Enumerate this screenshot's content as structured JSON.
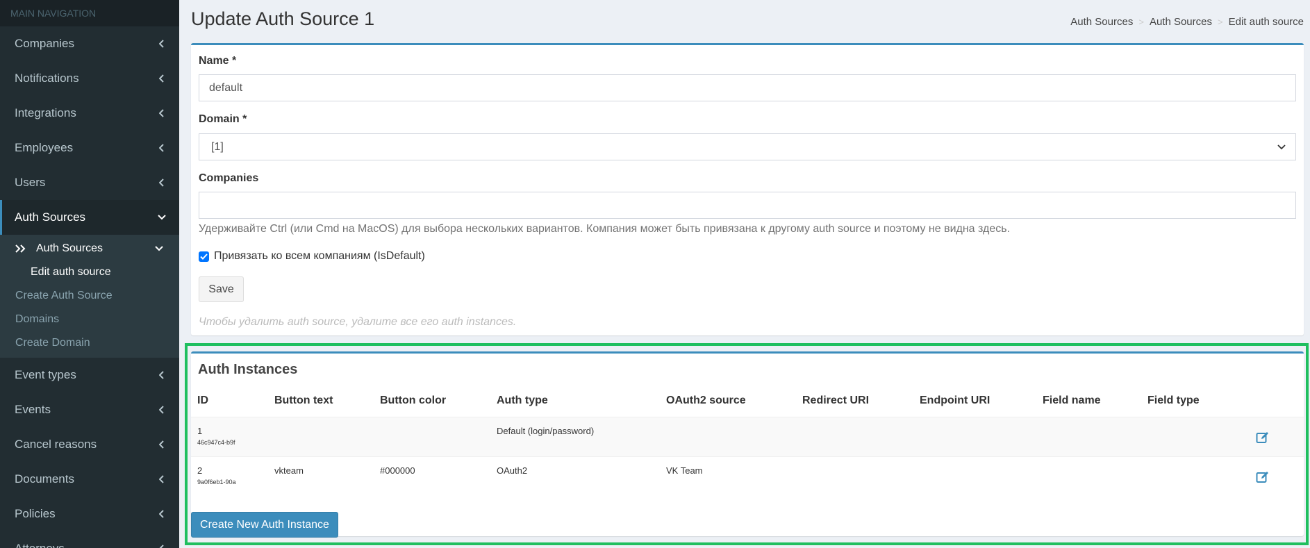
{
  "sidebar": {
    "header": "MAIN NAVIGATION",
    "items": [
      {
        "label": "Companies"
      },
      {
        "label": "Notifications"
      },
      {
        "label": "Integrations"
      },
      {
        "label": "Employees"
      },
      {
        "label": "Users"
      },
      {
        "label": "Auth Sources"
      }
    ],
    "submenu": {
      "auth_sources": "Auth Sources",
      "edit_auth_source": "Edit auth source",
      "create_auth_source": "Create Auth Source",
      "domains": "Domains",
      "create_domain": "Create Domain"
    },
    "items_after": [
      {
        "label": "Event types"
      },
      {
        "label": "Events"
      },
      {
        "label": "Cancel reasons"
      },
      {
        "label": "Documents"
      },
      {
        "label": "Policies"
      },
      {
        "label": "Attorneys"
      }
    ]
  },
  "header": {
    "title": "Update Auth Source 1",
    "breadcrumb": [
      "Auth Sources",
      "Auth Sources",
      "Edit auth source"
    ]
  },
  "form": {
    "name_label": "Name *",
    "name_value": "default",
    "domain_label": "Domain *",
    "domain_value": "[1]",
    "companies_label": "Companies",
    "companies_help": "Удерживайте Ctrl (или Cmd на MacOS) для выбора нескольких вариантов. Компания может быть привязана к другому auth source и поэтому не видна здесь.",
    "is_default_label": "Привязать ко всем компаниям (IsDefault)",
    "is_default_checked": true,
    "save_label": "Save",
    "delete_note": "Чтобы удалить auth source, удалите все его auth instances."
  },
  "instances": {
    "title": "Auth Instances",
    "columns": [
      "ID",
      "Button text",
      "Button color",
      "Auth type",
      "OAuth2 source",
      "Redirect URI",
      "Endpoint URI",
      "Field name",
      "Field type"
    ],
    "rows": [
      {
        "id": "1",
        "uuid": "46c947c4-b9f",
        "button_text": "",
        "button_color": "",
        "auth_type": "Default (login/password)",
        "oauth2_source": "",
        "redirect_uri": "",
        "endpoint_uri": "",
        "field_name": "",
        "field_type": ""
      },
      {
        "id": "2",
        "uuid": "9a0f6eb1-90a",
        "button_text": "vkteam",
        "button_color": "#000000",
        "auth_type": "OAuth2",
        "oauth2_source": "VK Team",
        "redirect_uri": "",
        "endpoint_uri": "",
        "field_name": "",
        "field_type": ""
      }
    ],
    "create_label": "Create New Auth Instance"
  },
  "colors": {
    "sidebar_bg": "#222d32",
    "accent": "#3c8dbc",
    "highlight": "#1fbf5f"
  }
}
